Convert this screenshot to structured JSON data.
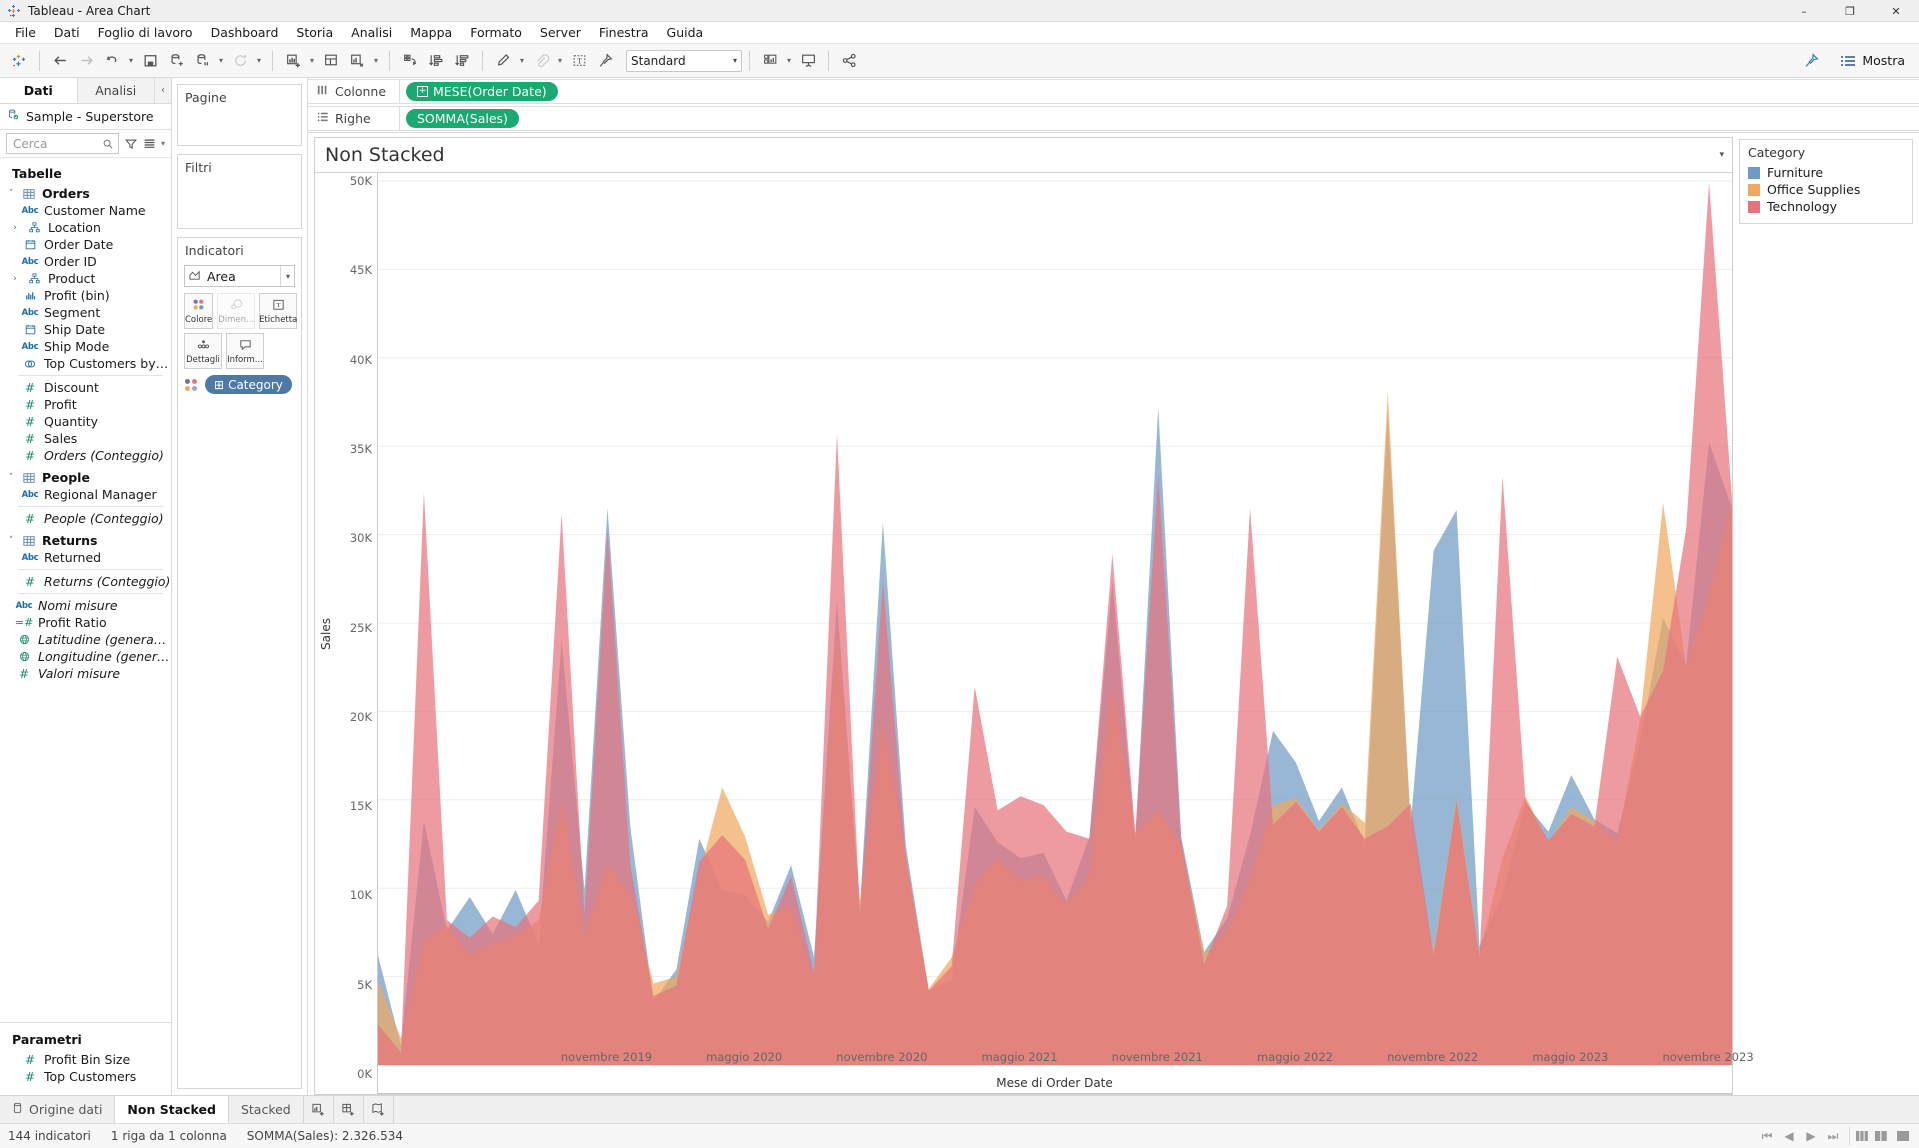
{
  "window": {
    "app_icon": "tableau-logo-icon",
    "title": "Tableau - Area Chart",
    "minimize": "–",
    "maximize": "❐",
    "close": "✕"
  },
  "menubar": {
    "items": [
      "File",
      "Dati",
      "Foglio di lavoro",
      "Dashboard",
      "Storia",
      "Analisi",
      "Mappa",
      "Formato",
      "Server",
      "Finestra",
      "Guida"
    ]
  },
  "toolbar": {
    "fit_value": "Standard",
    "show_label": "Mostra",
    "buttons": [
      "tableau-home-icon",
      "back-arrow-icon",
      "forward-arrow-icon",
      "undo-redo-icon",
      "save-icon",
      "new-data-source-icon",
      "pause-data-source-icon",
      "refresh-data-icon",
      "new-worksheet-icon",
      "new-dashboard-icon",
      "new-story-icon",
      "clear-sheet-icon",
      "sort-ascending-icon",
      "sort-descending-icon",
      "highlighter-icon",
      "attach-icon",
      "text-annotation-icon",
      "fixed-axis-icon",
      "presentation-layout-icon",
      "presentation-mode-icon",
      "share-icon",
      "show-me-icon"
    ]
  },
  "sidebar": {
    "tabs": [
      {
        "label": "Dati",
        "active": true
      },
      {
        "label": "Analisi",
        "active": false
      }
    ],
    "collapse_icon": "chevron-left-icon",
    "datasource": {
      "icon": "datasource-connected-icon",
      "name": "Sample - Superstore"
    },
    "search": {
      "placeholder": "Cerca",
      "value": "",
      "icon": "search-icon",
      "filter_icon": "filter-icon",
      "view_icon": "grid-view-icon",
      "view_caret": "▾"
    },
    "section_title": "Tabelle",
    "groups": [
      {
        "name": "Orders",
        "icon": "table-icon",
        "expander": "˅",
        "fields": [
          {
            "label": "Customer Name",
            "icon": "Abc",
            "kind": "dim"
          },
          {
            "label": "Location",
            "icon": "hierarchy-icon",
            "kind": "dim",
            "expandable": true
          },
          {
            "label": "Order Date",
            "icon": "calendar-icon",
            "kind": "dim"
          },
          {
            "label": "Order ID",
            "icon": "Abc",
            "kind": "dim"
          },
          {
            "label": "Product",
            "icon": "hierarchy-icon",
            "kind": "dim",
            "expandable": true
          },
          {
            "label": "Profit (bin)",
            "icon": "bin-icon",
            "kind": "dim"
          },
          {
            "label": "Segment",
            "icon": "Abc",
            "kind": "dim"
          },
          {
            "label": "Ship Date",
            "icon": "calendar-icon",
            "kind": "dim"
          },
          {
            "label": "Ship Mode",
            "icon": "Abc",
            "kind": "dim"
          },
          {
            "label": "Top Customers by Profit",
            "icon": "set-icon",
            "kind": "dim"
          },
          {
            "label": "Discount",
            "icon": "#",
            "kind": "measure",
            "divider_above": true
          },
          {
            "label": "Profit",
            "icon": "#",
            "kind": "measure"
          },
          {
            "label": "Quantity",
            "icon": "#",
            "kind": "measure"
          },
          {
            "label": "Sales",
            "icon": "#",
            "kind": "measure"
          },
          {
            "label": "Orders (Conteggio)",
            "icon": "#",
            "kind": "measure",
            "italic": true
          }
        ]
      },
      {
        "name": "People",
        "icon": "table-icon",
        "expander": "˅",
        "fields": [
          {
            "label": "Regional Manager",
            "icon": "Abc",
            "kind": "dim"
          },
          {
            "label": "People (Conteggio)",
            "icon": "#",
            "kind": "measure",
            "italic": true,
            "divider_above": true
          }
        ]
      },
      {
        "name": "Returns",
        "icon": "table-icon",
        "expander": "˅",
        "fields": [
          {
            "label": "Returned",
            "icon": "Abc",
            "kind": "dim"
          },
          {
            "label": "Returns (Conteggio)",
            "icon": "#",
            "kind": "measure",
            "italic": true,
            "divider_above": true
          }
        ]
      }
    ],
    "extra_fields": [
      {
        "label": "Nomi misure",
        "icon": "Abc",
        "kind": "dim",
        "italic": true
      },
      {
        "label": "Profit Ratio",
        "icon": "calc-measure-icon",
        "kind": "measure"
      },
      {
        "label": "Latitudine (generata)",
        "icon": "globe-icon",
        "kind": "measure",
        "italic": true
      },
      {
        "label": "Longitudine (generata)",
        "icon": "globe-icon",
        "kind": "measure",
        "italic": true
      },
      {
        "label": "Valori misure",
        "icon": "#",
        "kind": "measure",
        "italic": true
      }
    ],
    "parameters": {
      "title": "Parametri",
      "items": [
        {
          "label": "Profit Bin Size",
          "icon": "#"
        },
        {
          "label": "Top Customers",
          "icon": "#"
        }
      ]
    }
  },
  "cards": {
    "pages": {
      "title": "Pagine"
    },
    "filters": {
      "title": "Filtri"
    },
    "marks": {
      "title": "Indicatori",
      "mark_type": "Area",
      "mark_type_icon": "area-mark-icon",
      "mark_caret": "▾",
      "buttons": [
        {
          "label": "Colore",
          "icon": "color-icon",
          "disabled": false
        },
        {
          "label": "Dimen...",
          "icon": "size-icon",
          "disabled": true
        },
        {
          "label": "Etichetta",
          "icon": "label-icon",
          "disabled": false
        },
        {
          "label": "Dettagli",
          "icon": "detail-icon",
          "disabled": false
        },
        {
          "label": "Inform...",
          "icon": "tooltip-icon",
          "disabled": false
        }
      ],
      "pills": [
        {
          "label": "Category",
          "icon": "color-legend-icon",
          "prefix": "⊞"
        }
      ]
    }
  },
  "shelves": [
    {
      "name": "Colonne",
      "icon": "columns-icon",
      "pills": [
        {
          "label": "MESE(Order Date)",
          "has_plus": true
        }
      ]
    },
    {
      "name": "Righe",
      "icon": "rows-icon",
      "pills": [
        {
          "label": "SOMMA(Sales)",
          "has_plus": false
        }
      ]
    }
  ],
  "view": {
    "title": "Non Stacked",
    "title_caret": "▾"
  },
  "legend": {
    "title": "Category",
    "items": [
      {
        "label": "Furniture",
        "color": "#6f9bc3"
      },
      {
        "label": "Office Supplies",
        "color": "#f0a martial"
      },
      {
        "label": "Technology",
        "color": "#e8737d"
      }
    ]
  },
  "bottom_tabs": {
    "datasource_tab": {
      "label": "Origine dati",
      "icon": "datasource-tab-icon"
    },
    "sheets": [
      {
        "label": "Non Stacked",
        "active": true
      },
      {
        "label": "Stacked",
        "active": false
      }
    ],
    "new_buttons": [
      {
        "icon": "new-worksheet-icon"
      },
      {
        "icon": "new-dashboard-icon"
      },
      {
        "icon": "new-story-icon"
      }
    ]
  },
  "statusbar": {
    "marks_count": "144 indicatori",
    "rows_cols": "1 riga da 1 colonna",
    "aggregate": "SOMMA(Sales): 2.326.534",
    "right_icons": [
      "first-page-icon",
      "prev-page-icon",
      "next-page-icon",
      "last-page-icon",
      "grid-small-icon",
      "grid-medium-icon",
      "grid-large-icon"
    ]
  },
  "chart_data": {
    "type": "area",
    "title": "Non Stacked",
    "stacked": false,
    "xlabel": "Mese di Order Date",
    "ylabel": "Sales",
    "ylim": [
      0,
      50000
    ],
    "ytick_labels": [
      "0K",
      "5K",
      "10K",
      "15K",
      "20K",
      "25K",
      "30K",
      "35K",
      "40K",
      "45K",
      "50K"
    ],
    "ytick_values": [
      0,
      5000,
      10000,
      15000,
      20000,
      25000,
      30000,
      35000,
      40000,
      45000,
      50000
    ],
    "grid": true,
    "legend_position": "right",
    "xtick_labels": [
      "novembre 2019",
      "maggio 2020",
      "novembre 2020",
      "maggio 2021",
      "novembre 2021",
      "maggio 2022",
      "novembre 2022",
      "maggio 2023",
      "novembre 2023"
    ],
    "xtick_indices": [
      10,
      16,
      22,
      28,
      34,
      40,
      46,
      52,
      58
    ],
    "x": [
      "gennaio 2019",
      "febbraio 2019",
      "marzo 2019",
      "aprile 2019",
      "maggio 2019",
      "giugno 2019",
      "luglio 2019",
      "agosto 2019",
      "settembre 2019",
      "ottobre 2019",
      "novembre 2019",
      "dicembre 2019",
      "gennaio 2020",
      "febbraio 2020",
      "marzo 2020",
      "aprile 2020",
      "maggio 2020",
      "giugno 2020",
      "luglio 2020",
      "agosto 2020",
      "settembre 2020",
      "ottobre 2020",
      "novembre 2020",
      "dicembre 2020",
      "gennaio 2021",
      "febbraio 2021",
      "marzo 2021",
      "aprile 2021",
      "maggio 2021",
      "giugno 2021",
      "luglio 2021",
      "agosto 2021",
      "settembre 2021",
      "ottobre 2021",
      "novembre 2021",
      "dicembre 2021",
      "gennaio 2022",
      "febbraio 2022",
      "marzo 2022",
      "aprile 2022",
      "maggio 2022",
      "giugno 2022",
      "luglio 2022",
      "agosto 2022",
      "settembre 2022",
      "ottobre 2022",
      "novembre 2022",
      "dicembre 2022",
      "gennaio 2023",
      "febbraio 2023",
      "marzo 2023",
      "aprile 2023",
      "maggio 2023",
      "giugno 2023",
      "luglio 2023",
      "agosto 2023",
      "settembre 2023",
      "ottobre 2023",
      "novembre 2023",
      "dicembre 2023"
    ],
    "series": [
      {
        "name": "Furniture",
        "color": "#6f9bc3",
        "values": [
          6200,
          1100,
          13800,
          7600,
          9500,
          7400,
          9900,
          6800,
          24000,
          9900,
          31500,
          13400,
          3600,
          5400,
          12800,
          9900,
          9600,
          8100,
          11300,
          6100,
          26200,
          8900,
          30700,
          12400,
          4200,
          4800,
          14600,
          12600,
          11700,
          12000,
          9300,
          12900,
          27300,
          12700,
          37200,
          12900,
          6400,
          8300,
          13000,
          18900,
          17100,
          13800,
          15700,
          12500,
          37000,
          13600,
          29100,
          31400,
          6700,
          9700,
          14800,
          13200,
          16400,
          13900,
          13100,
          18400,
          25300,
          22600,
          35200,
          31500
        ]
      },
      {
        "name": "Office Supplies",
        "color": "#f0a860",
        "values": [
          4800,
          1500,
          7100,
          7900,
          6200,
          6900,
          7300,
          8200,
          15000,
          7400,
          11400,
          9700,
          4600,
          5000,
          10800,
          15700,
          12900,
          8500,
          9000,
          4900,
          24800,
          9300,
          19400,
          11900,
          4300,
          6100,
          10200,
          11700,
          10400,
          10700,
          9000,
          10800,
          21500,
          13100,
          14400,
          12400,
          6300,
          7600,
          10500,
          14700,
          15100,
          13300,
          14800,
          13700,
          38100,
          13400,
          6500,
          15100,
          6300,
          11700,
          15200,
          12600,
          14600,
          13800,
          12600,
          19600,
          31800,
          22500,
          26600,
          31800
        ]
      },
      {
        "name": "Technology",
        "color": "#e8737d"
      }
    ],
    "series_technology_values": [
      2300,
      700,
      32400,
      8200,
      7200,
      8400,
      7800,
      9300,
      31200,
      8500,
      30200,
      11300,
      3900,
      4500,
      11500,
      13000,
      11600,
      7700,
      10700,
      5200,
      35700,
      8600,
      27400,
      11800,
      4200,
      5600,
      21400,
      14400,
      15200,
      14700,
      13200,
      12800,
      28900,
      13100,
      33400,
      12700,
      5700,
      9000,
      31500,
      13600,
      14900,
      13200,
      14600,
      12800,
      13500,
      14800,
      6200,
      14900,
      6100,
      33300,
      15000,
      12700,
      14200,
      13500,
      23100,
      19700,
      22300,
      30300,
      49900,
      32000
    ]
  }
}
